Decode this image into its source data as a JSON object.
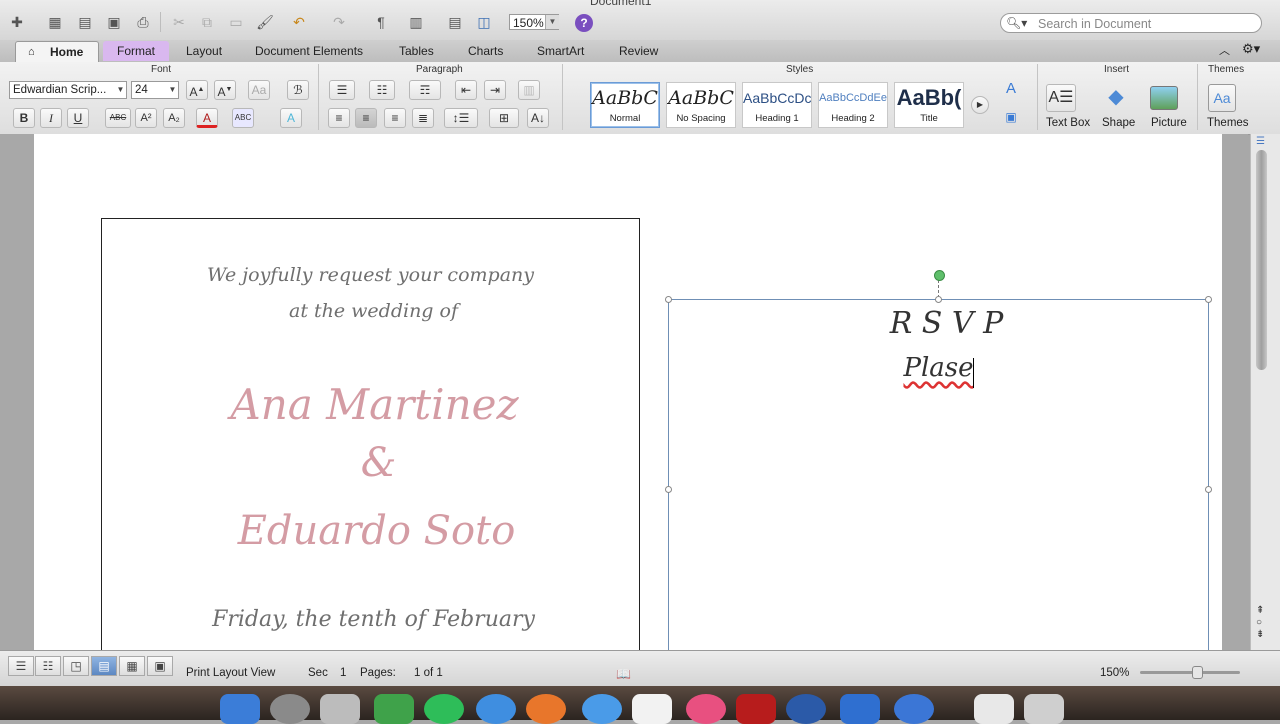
{
  "window": {
    "title": "Document1"
  },
  "toolbar": {
    "zoom_value": "150%",
    "help_glyph": "?",
    "search_placeholder": "Search in Document",
    "pilcrow": "¶"
  },
  "ribbon_tabs": [
    "Home",
    "Format",
    "Layout",
    "Document Elements",
    "Tables",
    "Charts",
    "SmartArt",
    "Review"
  ],
  "groups": {
    "font": "Font",
    "paragraph": "Paragraph",
    "styles": "Styles",
    "insert": "Insert",
    "themes": "Themes"
  },
  "font": {
    "name": "Edwardian Scrip...",
    "size": "24",
    "bold": "B",
    "italic": "I",
    "underline": "U",
    "strike": "ABC",
    "superscript": "A²",
    "subscript": "A₂"
  },
  "styles": [
    {
      "sample": "AaBbC",
      "name": "Normal",
      "selected": true
    },
    {
      "sample": "AaBbC",
      "name": "No Spacing",
      "selected": false
    },
    {
      "sample": "AaBbCcDc",
      "name": "Heading 1",
      "selected": false
    },
    {
      "sample": "AaBbCcDdEe",
      "name": "Heading 2",
      "selected": false
    },
    {
      "sample": "AaBb(",
      "name": "Title",
      "selected": false
    }
  ],
  "insert": {
    "text_box": "Text Box",
    "shape": "Shape",
    "picture": "Picture",
    "themes": "Themes"
  },
  "invitation": {
    "line1": "We joyfully request your company",
    "line2": "at the wedding of",
    "name1": "Ana Martinez",
    "ampersand": "&",
    "name2": "Eduardo Soto",
    "date": "Friday, the tenth of February"
  },
  "rsvp": {
    "title": "R S V P",
    "typed": "Plase"
  },
  "status": {
    "view": "Print Layout View",
    "sec_label": "Sec",
    "sec_value": "1",
    "pages_label": "Pages:",
    "pages_value": "1 of 1",
    "zoom": "150%"
  },
  "colors": {
    "accent_format_tab": "#d9b8ef",
    "script_grey": "#6f6f6f",
    "script_pink": "#d49ca4",
    "rotate_handle": "#5fbf6b"
  }
}
